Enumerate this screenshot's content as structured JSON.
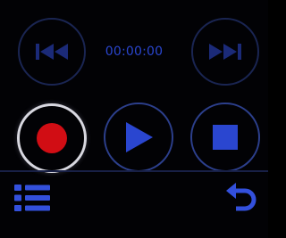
{
  "timer": {
    "elapsed": "00:00:00"
  },
  "icons": {
    "previous": "skip-previous-icon",
    "next": "skip-next-icon",
    "record": "record-icon",
    "play": "play-icon",
    "stop": "stop-icon",
    "list": "list-icon",
    "back": "back-arrow-icon"
  },
  "colors": {
    "accent": "#2a46d0",
    "record": "#d10d14",
    "dim_icon": "#1b2a78",
    "background": "#020205"
  }
}
